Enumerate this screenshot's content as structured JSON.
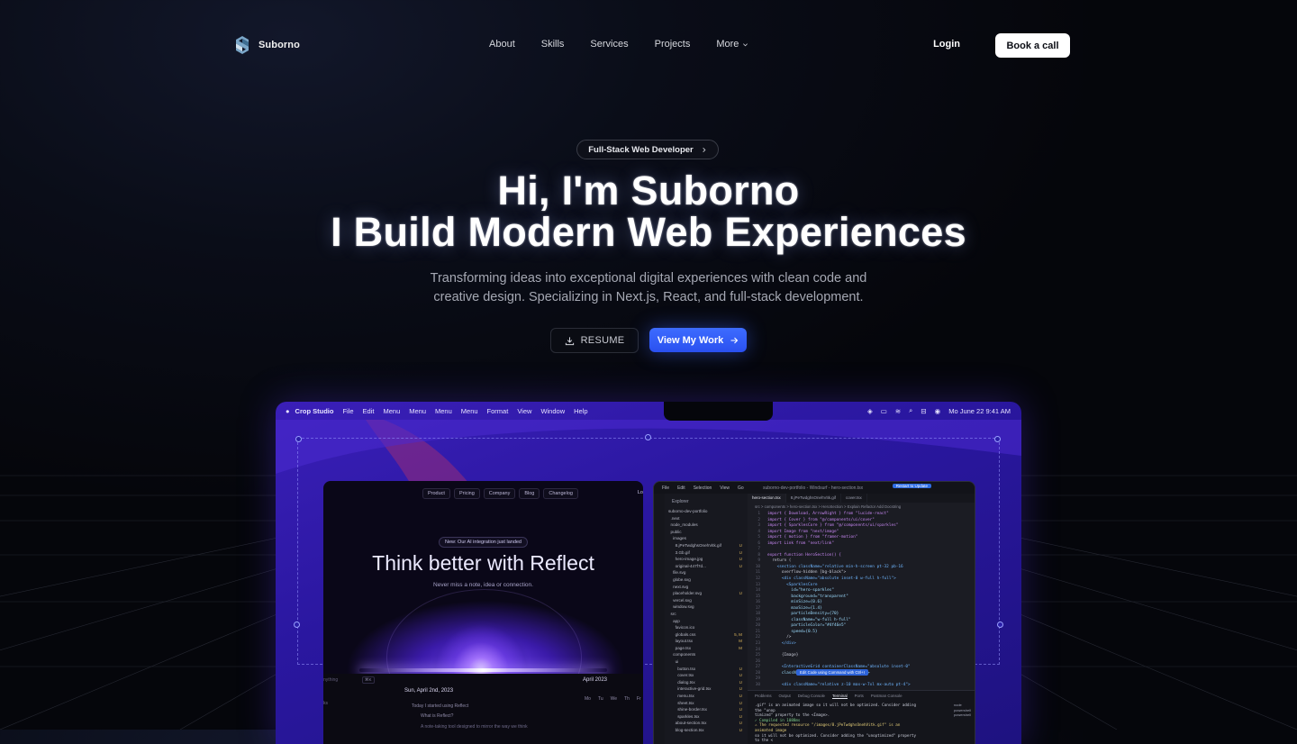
{
  "nav": {
    "brand": "Suborno",
    "links": [
      "About",
      "Skills",
      "Services",
      "Projects"
    ],
    "more": "More",
    "login": "Login",
    "cta": "Book a call"
  },
  "hero": {
    "badge": "Full-Stack Web Developer",
    "title_line1": "Hi, I'm Suborno",
    "title_line2": "I Build Modern Web Experiences",
    "subtitle_line1": "Transforming ideas into exceptional digital experiences with clean code and",
    "subtitle_line2": "creative design. Specializing in Next.js, React, and full-stack development.",
    "resume_button": "RESUME",
    "work_button": "View My Work"
  },
  "mockup": {
    "menubar": {
      "app": "Crop Studio",
      "items": [
        "File",
        "Edit",
        "Menu",
        "Menu",
        "Menu",
        "Menu",
        "Format",
        "View",
        "Window",
        "Help"
      ],
      "datetime": "Mo June 22  9:41 AM"
    },
    "reflect": {
      "nav": [
        "Product",
        "Pricing",
        "Company",
        "Blog",
        "Changelog"
      ],
      "login": "Lo",
      "announcement": "New: Our AI integration just landed",
      "title": "Think better with Reflect",
      "tagline": "Never miss a note, idea or connection.",
      "date": "Sun, April 2nd, 2023",
      "notes": [
        "Today I started using Reflect",
        "What is Reflect?",
        "A note-taking tool designed to mirror the way we think"
      ],
      "calendar_title": "April 2023",
      "calendar_days": [
        "Mo",
        "Tu",
        "We",
        "Th",
        "Fr"
      ],
      "search_label": "nything",
      "kbd": "⌘K",
      "left_tiny": "ks"
    },
    "editor": {
      "menu": [
        "File",
        "Edit",
        "Selection",
        "View",
        "Go"
      ],
      "path": "suborno-dev-portfolio - Windsurf - hero-section.tsx",
      "button": "Restart to Update",
      "explorer_header": "Explorer",
      "files": [
        {
          "name": "suborno-dev-portfolio",
          "status": ""
        },
        {
          "name": "  .next",
          "status": ""
        },
        {
          "name": "  node_modules",
          "status": ""
        },
        {
          "name": "  public",
          "status": ""
        },
        {
          "name": "    images",
          "status": ""
        },
        {
          "name": "      8.jPeTwdghsOnehVitk.gif",
          "status": "U"
        },
        {
          "name": "      3.Gb.gif",
          "status": "U"
        },
        {
          "name": "      hero-image.jpg",
          "status": "U"
        },
        {
          "name": "      original-447f7d...",
          "status": "U"
        },
        {
          "name": "    file.svg",
          "status": ""
        },
        {
          "name": "    globe.svg",
          "status": ""
        },
        {
          "name": "    next.svg",
          "status": ""
        },
        {
          "name": "    placeholder.svg",
          "status": "U"
        },
        {
          "name": "    vercel.svg",
          "status": ""
        },
        {
          "name": "    window.svg",
          "status": ""
        },
        {
          "name": "  src",
          "status": ""
        },
        {
          "name": "    app",
          "status": ""
        },
        {
          "name": "      favicon.ico",
          "status": ""
        },
        {
          "name": "      globals.css",
          "status": "5, M"
        },
        {
          "name": "      layout.tsx",
          "status": "M"
        },
        {
          "name": "      page.tsx",
          "status": "M"
        },
        {
          "name": "    components",
          "status": ""
        },
        {
          "name": "      ui",
          "status": ""
        },
        {
          "name": "        button.tsx",
          "status": "U"
        },
        {
          "name": "        cover.tsx",
          "status": "U"
        },
        {
          "name": "        dialog.tsx",
          "status": "U"
        },
        {
          "name": "        interactive-grid.tsx",
          "status": "U"
        },
        {
          "name": "        menu.tsx",
          "status": "U"
        },
        {
          "name": "        sheet.tsx",
          "status": "U"
        },
        {
          "name": "        shine-border.tsx",
          "status": "U"
        },
        {
          "name": "        sparkles.tsx",
          "status": "U"
        },
        {
          "name": "      about-section.tsx",
          "status": "U"
        },
        {
          "name": "      blog-section.tsx",
          "status": "U"
        }
      ],
      "tabs": [
        "hero-section.tsx",
        "8.jPeTwdghsOnehVitk.gif",
        "cover.tsx"
      ],
      "crumbs": "src > components > hero-section.tsx > HeroSection > Explain  Refactor  Add Docstring",
      "code": [
        {
          "n": "1",
          "t": "import { Download, ArrowRight } from \"lucide-react\""
        },
        {
          "n": "2",
          "t": "import { Cover } from \"@/components/ui/cover\""
        },
        {
          "n": "3",
          "t": "import { SparklesCore } from \"@/components/ui/sparkles\""
        },
        {
          "n": "4",
          "t": "import Image from \"next/image\""
        },
        {
          "n": "5",
          "t": "import { motion } from \"framer-motion\""
        },
        {
          "n": "6",
          "t": "import Link from \"next/link\""
        },
        {
          "n": "7",
          "t": ""
        },
        {
          "n": "8",
          "t": "export function HeroSection() {"
        },
        {
          "n": "9",
          "t": "  return ("
        },
        {
          "n": "10",
          "t": "    <section className=\"relative min-h-screen pt-32 pb-16"
        },
        {
          "n": "11",
          "t": "      overflow-hidden [bg-black\">"
        },
        {
          "n": "12",
          "t": "      <div className=\"absolute inset-0 w-full h-full\">"
        },
        {
          "n": "13",
          "t": "        <SparklesCore"
        },
        {
          "n": "14",
          "t": "          id=\"hero-sparkles\""
        },
        {
          "n": "15",
          "t": "          background=\"transparent\""
        },
        {
          "n": "16",
          "t": "          minSize={0.6}"
        },
        {
          "n": "17",
          "t": "          maxSize={1.4}"
        },
        {
          "n": "18",
          "t": "          particleDensity={70}"
        },
        {
          "n": "19",
          "t": "          className=\"w-full h-full\""
        },
        {
          "n": "20",
          "t": "          particleColor=\"#4f46e5\""
        },
        {
          "n": "21",
          "t": "          speed={0.5}"
        },
        {
          "n": "22",
          "t": "        />"
        },
        {
          "n": "23",
          "t": "      </div>"
        },
        {
          "n": "24",
          "t": ""
        },
        {
          "n": "25",
          "t": "      {Image}"
        },
        {
          "n": "26",
          "t": ""
        },
        {
          "n": "27",
          "t": "      <InteractiveGrid containerClassName=\"absolute inset-0\""
        },
        {
          "n": "28",
          "t": "      className=\"opacity-30\" points={40} />"
        },
        {
          "n": "29",
          "t": ""
        },
        {
          "n": "30",
          "t": "      <div className=\"relative z-10 max-w-7xl mx-auto pt-4\">"
        }
      ],
      "hint": "Edit Code using Command with Ctrl+I",
      "panel_tabs": [
        "Problems",
        "Output",
        "Debug Console",
        "Terminal",
        "Ports",
        "Postman Console"
      ],
      "terminal": [
        ".gif\" is an animated image so it will not be optimized. Consider adding the \"unop",
        "timized\" property to the <Image>.",
        "✓ Compiled in 1088ms",
        "⚠ The requested resource \"/images/8.jPeTwdghsOnehVitk.gif\" is an animated image",
        "so it will not be optimized. Consider adding the \"unoptimized\" property to the <"
      ],
      "terminal_side": [
        "node",
        "powershell",
        "powershell"
      ]
    }
  }
}
